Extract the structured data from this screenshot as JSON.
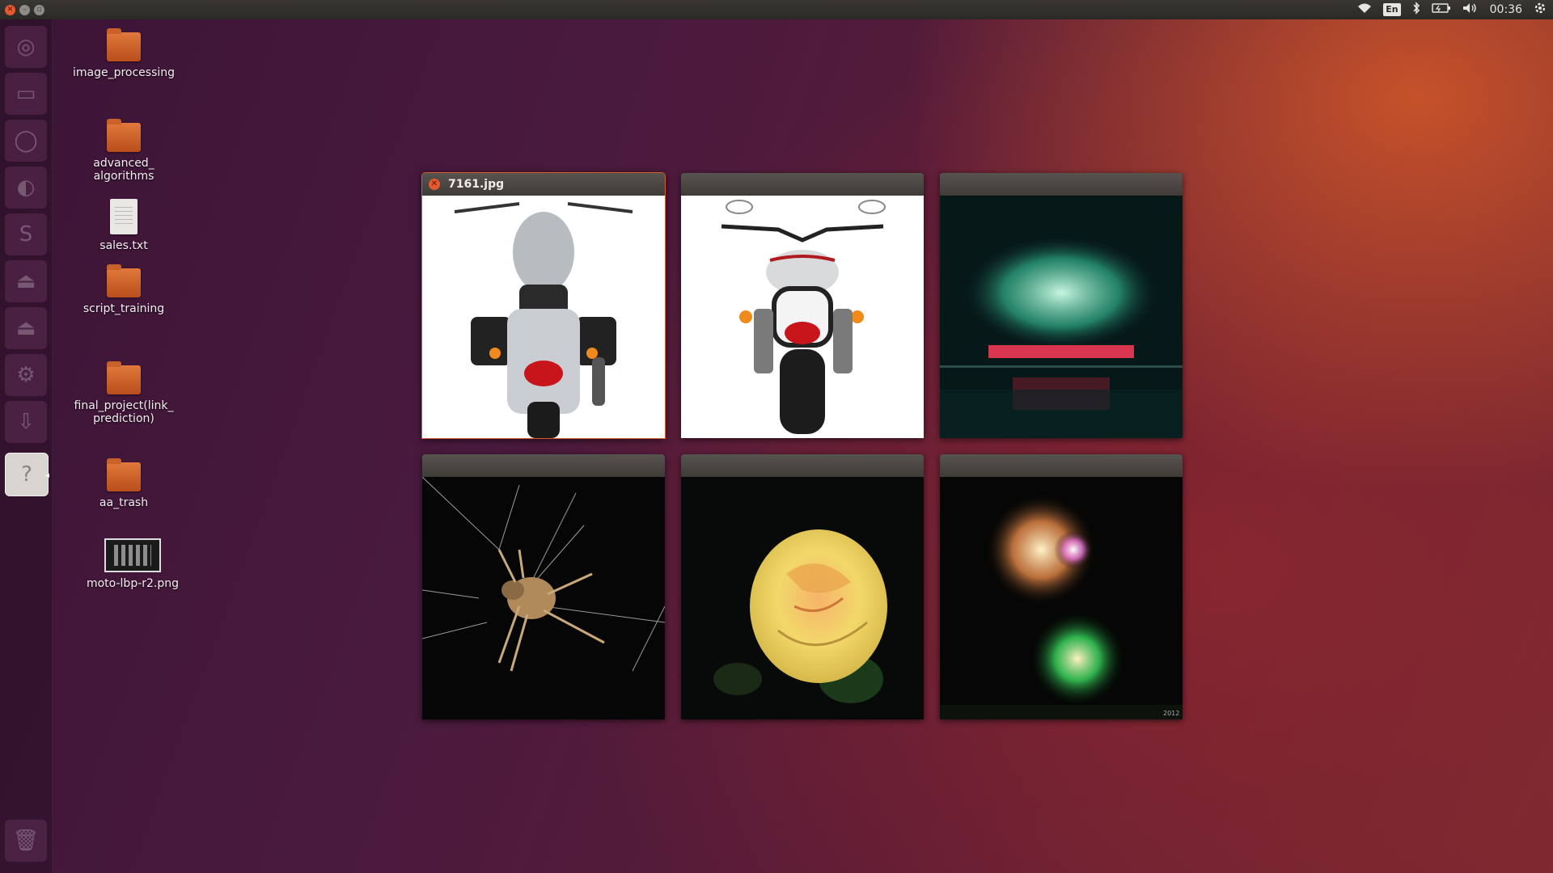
{
  "topbar": {
    "window_controls": [
      "close-icon",
      "minimize-icon",
      "maximize-icon"
    ],
    "keyboard_layout": "En",
    "clock": "00:36",
    "indicators": [
      "wifi-icon",
      "keyboard-layout",
      "bluetooth-icon",
      "battery-icon",
      "volume-icon",
      "clock",
      "power-icon"
    ]
  },
  "launcher": {
    "items": [
      {
        "name": "dash-home-icon"
      },
      {
        "name": "files-icon"
      },
      {
        "name": "browser-icon"
      },
      {
        "name": "firefox-icon"
      },
      {
        "name": "sublime-text-icon"
      },
      {
        "name": "drive-icon"
      },
      {
        "name": "drive-icon-2"
      },
      {
        "name": "system-settings-icon"
      },
      {
        "name": "software-updater-icon"
      },
      {
        "name": "unknown-app-icon",
        "glyph": "?"
      },
      {
        "name": "trash-icon"
      }
    ]
  },
  "desktop": {
    "icons": [
      {
        "label": "image_processing",
        "type": "folder"
      },
      {
        "label": "advanced_\nalgorithms",
        "type": "folder"
      },
      {
        "label": "sales.txt",
        "type": "text"
      },
      {
        "label": "script_training",
        "type": "folder"
      },
      {
        "label": "final_project(link_\nprediction)",
        "type": "folder"
      },
      {
        "label": "aa_trash",
        "type": "folder"
      },
      {
        "label": "moto-lbp-r2.png",
        "type": "image"
      }
    ]
  },
  "spread": {
    "windows": [
      {
        "title": "7161.jpg",
        "focused": true,
        "content": "motorcycle rear view (white background)"
      },
      {
        "title": "",
        "focused": false,
        "content": "motorcycle rear view (white background)"
      },
      {
        "title": "",
        "focused": false,
        "content": "fireworks over water"
      },
      {
        "title": "",
        "focused": false,
        "content": "spider on web"
      },
      {
        "title": "",
        "focused": false,
        "content": "yellow rose"
      },
      {
        "title": "",
        "focused": false,
        "content": "fireworks at night"
      }
    ],
    "watermark_text": "2012"
  },
  "colors": {
    "accent": "#e5592e",
    "panel": "#2b2926"
  }
}
